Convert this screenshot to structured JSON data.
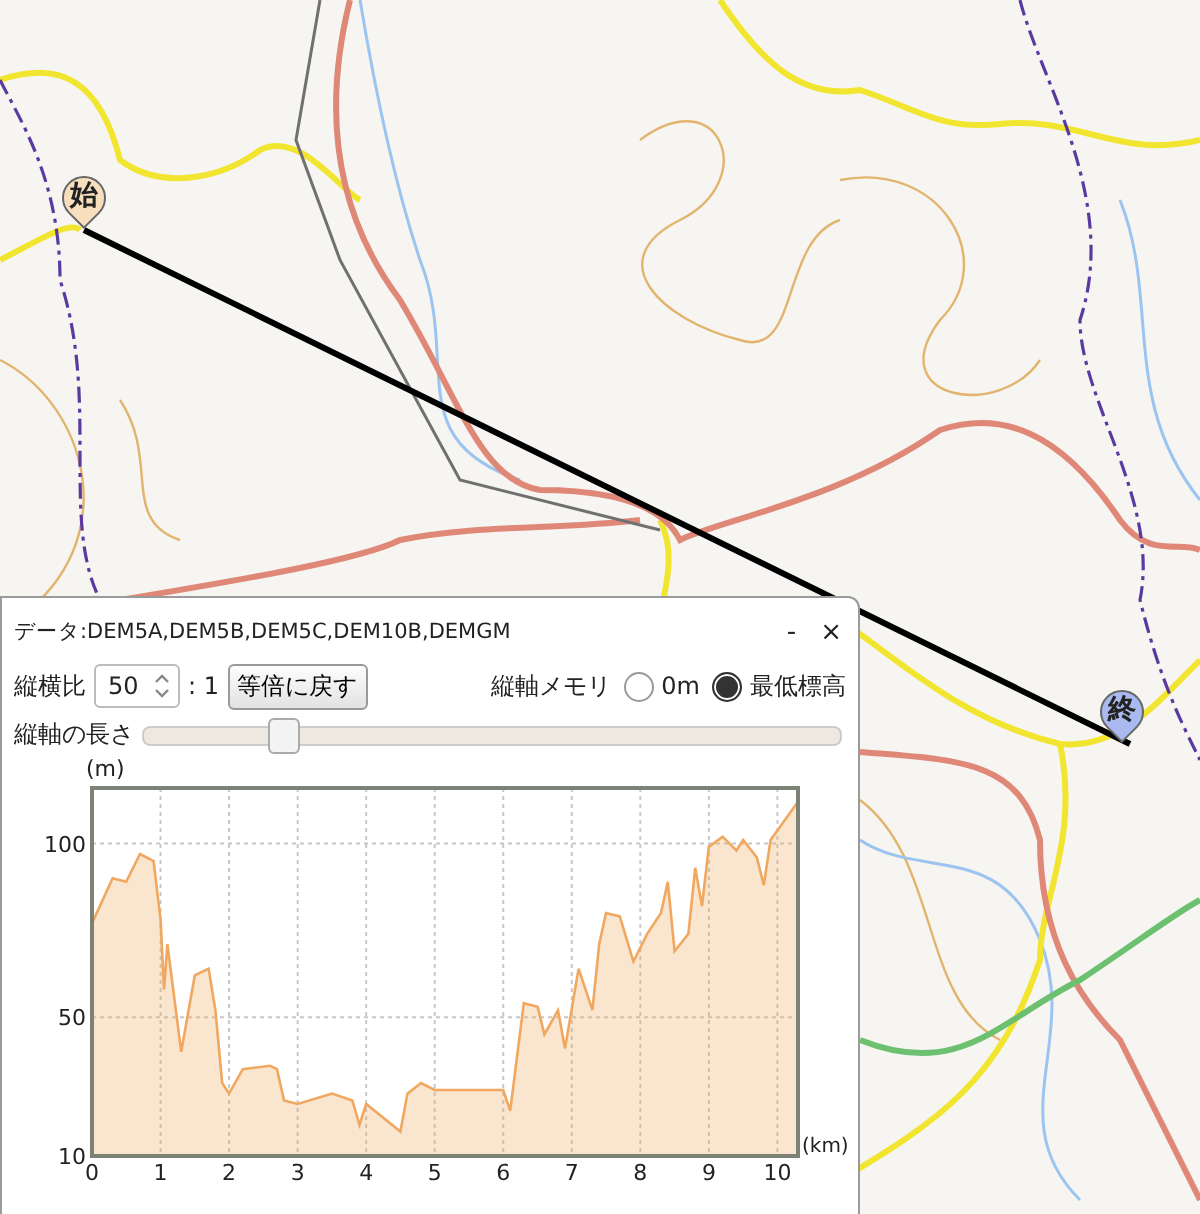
{
  "map": {
    "start_marker": "始",
    "end_marker": "終"
  },
  "profile_panel": {
    "data_label": "データ:DEM5A,DEM5B,DEM5C,DEM10B,DEMGM",
    "minimize": "-",
    "close": "×",
    "ratio_label": "縦横比",
    "ratio_value": "50",
    "ratio_suffix": ": 1",
    "reset_button": "等倍に戻す",
    "axis_base_label": "縦軸メモリ",
    "axis_base_options": [
      {
        "label": "0m",
        "selected": false
      },
      {
        "label": "最低標高",
        "selected": true
      }
    ],
    "axis_length": {
      "label": "縦軸の長さ",
      "level": 0.2
    },
    "chart_data": {
      "type": "area",
      "grid": true,
      "xlabel": "(km)",
      "ylabel": "(m)",
      "xlim": [
        0,
        10.3
      ],
      "ylim": [
        10,
        116
      ],
      "xticks": [
        0,
        1,
        2,
        3,
        4,
        5,
        6,
        7,
        8,
        9,
        10
      ],
      "yticks": [
        10,
        50,
        100
      ],
      "x": [
        0,
        0.3,
        0.5,
        0.7,
        0.9,
        1.0,
        1.05,
        1.1,
        1.3,
        1.5,
        1.7,
        1.8,
        1.9,
        2.0,
        2.2,
        2.6,
        2.7,
        2.8,
        3.0,
        3.5,
        3.8,
        3.9,
        4.0,
        4.5,
        4.6,
        4.8,
        5.0,
        6.0,
        6.1,
        6.3,
        6.5,
        6.6,
        6.8,
        6.9,
        7.1,
        7.3,
        7.4,
        7.5,
        7.7,
        7.9,
        8.1,
        8.3,
        8.4,
        8.5,
        8.7,
        8.8,
        8.9,
        9.0,
        9.2,
        9.4,
        9.5,
        9.7,
        9.8,
        9.9,
        10.3
      ],
      "series": [
        {
          "color": "#f0a860",
          "values": [
            77,
            90,
            89,
            97,
            95,
            78,
            58,
            71,
            40,
            62,
            64,
            52,
            31,
            28,
            35,
            36,
            35,
            26,
            25,
            28,
            26,
            19,
            25,
            17,
            28,
            31,
            29,
            29,
            23,
            54,
            53,
            45,
            52,
            41,
            64,
            52,
            71,
            80,
            79,
            66,
            74,
            80,
            89,
            69,
            74,
            93,
            82,
            99,
            102,
            98,
            101,
            96,
            88,
            101,
            112
          ]
        }
      ]
    }
  }
}
